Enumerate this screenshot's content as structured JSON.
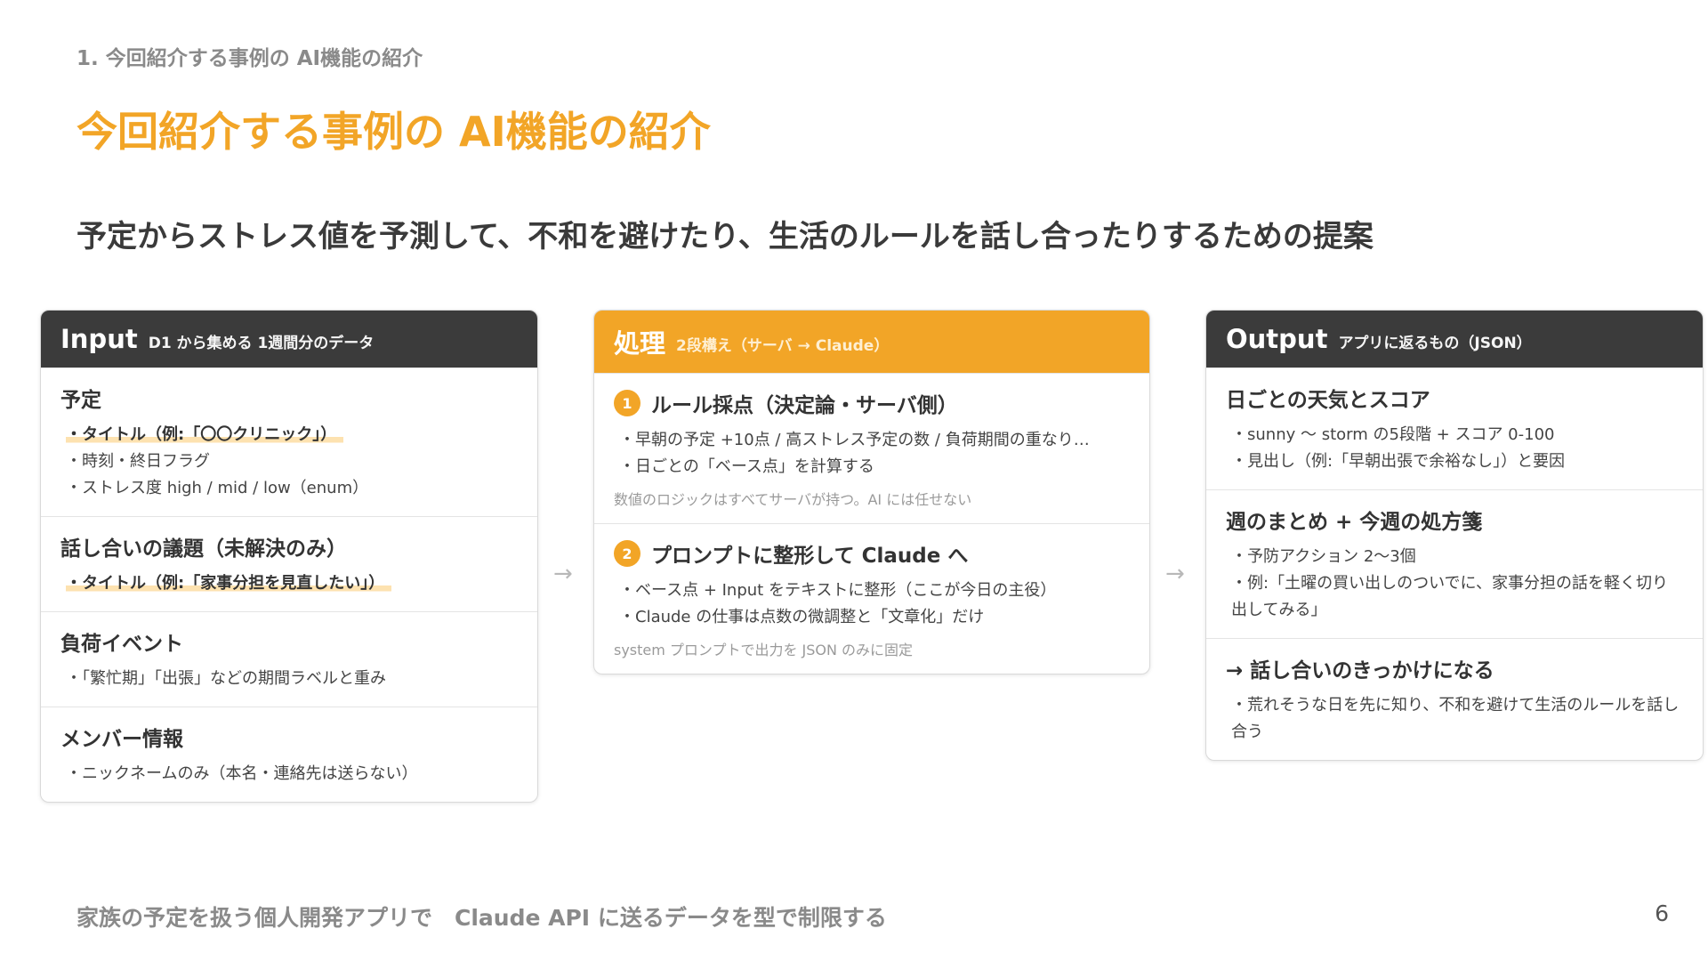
{
  "breadcrumb": "1. 今回紹介する事例の AI機能の紹介",
  "title": "今回紹介する事例の AI機能の紹介",
  "subtitle": "予定からストレス値を予測して、不和を避けたり、生活のルールを話し合ったりするための提案",
  "input_card": {
    "title": "Input",
    "subtitle": "D1 から集める 1週間分のデータ",
    "sections": [
      {
        "title": "予定",
        "bullets": [
          "・タイトル（例:「〇〇クリニック」）",
          "・時刻・終日フラグ",
          "・ストレス度 high / mid / low（enum）"
        ]
      },
      {
        "title": "話し合いの議題（未解決のみ）",
        "bullets": [
          "・タイトル（例:「家事分担を見直したい」）"
        ]
      },
      {
        "title": "負荷イベント",
        "bullets": [
          "・「繁忙期」「出張」などの期間ラベルと重み"
        ]
      },
      {
        "title": "メンバー情報",
        "bullets": [
          "・ニックネームのみ（本名・連絡先は送らない）"
        ]
      }
    ]
  },
  "process_card": {
    "title": "処理",
    "subtitle": "2段構え（サーバ → Claude）",
    "steps": [
      {
        "number": "1",
        "title": "ルール採点（決定論・サーバ側）",
        "bullets": [
          "・早朝の予定 +10点 / 高ストレス予定の数 / 負荷期間の重なり…",
          "・日ごとの「ベース点」を計算する"
        ],
        "note": "数値のロジックはすべてサーバが持つ。AI には任せない"
      },
      {
        "number": "2",
        "title": "プロンプトに整形して Claude へ",
        "bullets": [
          "・ベース点 + Input をテキストに整形（ここが今日の主役）",
          "・Claude の仕事は点数の微調整と「文章化」だけ"
        ],
        "note": "system プロンプトで出力を JSON のみに固定"
      }
    ]
  },
  "output_card": {
    "title": "Output",
    "subtitle": "アプリに返るもの（JSON）",
    "sections": [
      {
        "title": "日ごとの天気とスコア",
        "bullets": [
          "・sunny 〜 storm の5段階 + スコア 0-100",
          "・見出し（例:「早朝出張で余裕なし」）と要因"
        ]
      },
      {
        "title": "週のまとめ + 今週の処方箋",
        "bullets": [
          "・予防アクション 2〜3個",
          "・例:「土曜の買い出しのついでに、家事分担の話を軽く切り出してみる」"
        ]
      },
      {
        "title": "→ 話し合いのきっかけになる",
        "bullets": [
          "・荒れそうな日を先に知り、不和を避けて生活のルールを話し合う"
        ]
      }
    ]
  },
  "arrow_glyph": "→",
  "footer": "家族の予定を扱う個人開発アプリで　Claude API に送るデータを型で制限する",
  "page_number": "6"
}
